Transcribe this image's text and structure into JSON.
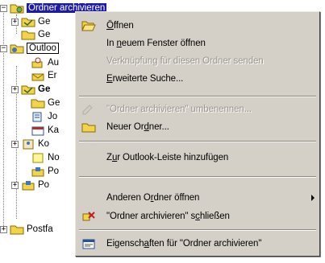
{
  "tree": {
    "items": [
      {
        "id": "r0",
        "label": "Ordner archivieren",
        "expander": "−",
        "icon": "archive-folder-icon",
        "style": "selected"
      },
      {
        "id": "r1",
        "label": "Ge",
        "expander": "+",
        "icon": "folder-icon",
        "style": ""
      },
      {
        "id": "r2",
        "label": "Ge",
        "expander": "",
        "icon": "folder-icon",
        "style": ""
      },
      {
        "id": "r3",
        "label": "Outloo",
        "expander": "−",
        "icon": "outlook-today-icon",
        "style": "boxed"
      },
      {
        "id": "r4",
        "label": "Au",
        "expander": "",
        "icon": "outbox-icon",
        "style": ""
      },
      {
        "id": "r5",
        "label": "Er",
        "expander": "",
        "icon": "sent-items-icon",
        "style": ""
      },
      {
        "id": "r6",
        "label": "Ge",
        "expander": "+",
        "icon": "folder-icon",
        "style": "bold"
      },
      {
        "id": "r7",
        "label": "Ge",
        "expander": "",
        "icon": "folder-icon",
        "style": ""
      },
      {
        "id": "r8",
        "label": "Jo",
        "expander": "",
        "icon": "journal-icon",
        "style": ""
      },
      {
        "id": "r9",
        "label": "Ka",
        "expander": "",
        "icon": "calendar-icon",
        "style": ""
      },
      {
        "id": "r10",
        "label": "Ko",
        "expander": "+",
        "icon": "contacts-icon",
        "style": ""
      },
      {
        "id": "r11",
        "label": "No",
        "expander": "",
        "icon": "notes-icon",
        "style": ""
      },
      {
        "id": "r12",
        "label": "Po",
        "expander": "",
        "icon": "inbox-icon",
        "style": ""
      },
      {
        "id": "r13",
        "label": "Po",
        "expander": "+",
        "icon": "inbox-icon",
        "style": ""
      },
      {
        "id": "r14",
        "label": "Postfa",
        "expander": "+",
        "icon": "mailbox-icon",
        "style": ""
      }
    ]
  },
  "menu": {
    "open": {
      "pre": "",
      "acc": "Ö",
      "post": "ffnen"
    },
    "open_new": {
      "pre": "In ",
      "acc": "n",
      "post": "euem Fenster öffnen"
    },
    "send_link": {
      "pre": "Verknüpfung für diesen Ordner senden",
      "acc": "",
      "post": ""
    },
    "adv_search": {
      "pre": "",
      "acc": "E",
      "post": "rweiterte Suche..."
    },
    "rename": {
      "pre": "\"Ordner archivieren\" umbenennen...",
      "acc": "",
      "post": ""
    },
    "new_folder": {
      "pre": "Neuer Or",
      "acc": "d",
      "post": "ner..."
    },
    "add_bar": {
      "pre": "Z",
      "acc": "u",
      "post": "r Outlook-Leiste hinzufügen"
    },
    "open_other": {
      "pre": "Anderen O",
      "acc": "r",
      "post": "dner öffnen"
    },
    "close": {
      "pre": "\"Ordner archivieren\" s",
      "acc": "c",
      "post": "hließen"
    },
    "properties": {
      "pre": "Eigensch",
      "acc": "a",
      "post": "ften für \"Ordner archivieren\""
    }
  },
  "colors": {
    "menu_bg": "#d4d0c8",
    "selection": "#1c1ca8",
    "disabled_text": "#9a968e",
    "folder_yellow": "#f2d34c"
  }
}
